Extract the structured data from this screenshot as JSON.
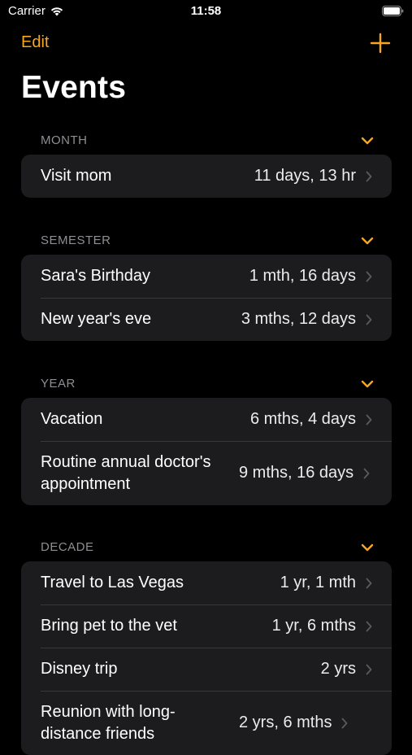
{
  "status": {
    "carrier": "Carrier",
    "time": "11:58"
  },
  "nav": {
    "edit_label": "Edit",
    "title": "Events"
  },
  "colors": {
    "accent": "#f5a623",
    "background": "#000000",
    "card": "#1c1c1e",
    "section_header": "#8e8e93"
  },
  "sections": [
    {
      "title": "MONTH",
      "rows": [
        {
          "title": "Visit mom",
          "value": "11 days, 13 hr"
        }
      ]
    },
    {
      "title": "SEMESTER",
      "rows": [
        {
          "title": "Sara's Birthday",
          "value": "1 mth, 16 days"
        },
        {
          "title": "New year's eve",
          "value": "3 mths, 12 days"
        }
      ]
    },
    {
      "title": "YEAR",
      "rows": [
        {
          "title": "Vacation",
          "value": "6 mths, 4 days"
        },
        {
          "title": "Routine annual doctor's appointment",
          "value": "9 mths, 16 days"
        }
      ]
    },
    {
      "title": "DECADE",
      "rows": [
        {
          "title": "Travel to Las Vegas",
          "value": "1 yr, 1 mth"
        },
        {
          "title": "Bring pet to the vet",
          "value": "1 yr, 6 mths"
        },
        {
          "title": "Disney trip",
          "value": "2 yrs"
        },
        {
          "title": "Reunion with long-distance friends",
          "value": "2 yrs, 6 mths"
        }
      ]
    }
  ]
}
